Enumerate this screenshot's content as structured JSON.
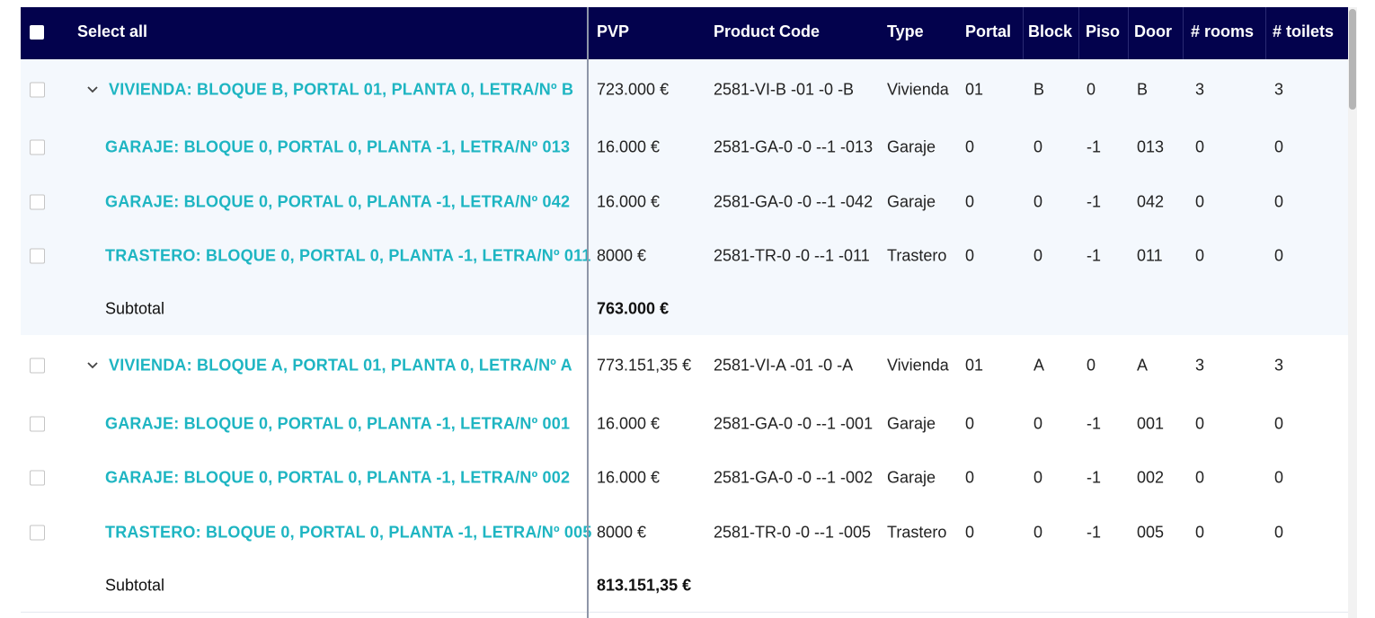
{
  "header": {
    "select_all": "Select all",
    "pvp": "PVP",
    "product_code": "Product Code",
    "type": "Type",
    "portal": "Portal",
    "block": "Block",
    "piso": "Piso",
    "door": "Door",
    "rooms": "# rooms",
    "toilets": "# toilets"
  },
  "colors": {
    "header_bg": "#03024d",
    "link": "#1eb5c2",
    "group_bg": "#f4f8fd"
  },
  "rows": [
    {
      "kind": "parent",
      "name": "VIVIENDA: BLOQUE B, PORTAL 01, PLANTA 0, LETRA/Nº B",
      "pvp": "723.000 €",
      "code": "2581-VI-B -01 -0 -B",
      "type": "Vivienda",
      "portal": "01",
      "block": "B",
      "piso": "0",
      "door": "B",
      "rooms": "3",
      "toilets": "3"
    },
    {
      "kind": "child",
      "name": "GARAJE: BLOQUE 0, PORTAL 0, PLANTA -1, LETRA/Nº 013",
      "pvp": "16.000 €",
      "code": "2581-GA-0 -0 --1 -013",
      "type": "Garaje",
      "portal": "0",
      "block": "0",
      "piso": "-1",
      "door": "013",
      "rooms": "0",
      "toilets": "0"
    },
    {
      "kind": "child",
      "name": "GARAJE: BLOQUE 0, PORTAL 0, PLANTA -1, LETRA/Nº 042",
      "pvp": "16.000 €",
      "code": "2581-GA-0 -0 --1 -042",
      "type": "Garaje",
      "portal": "0",
      "block": "0",
      "piso": "-1",
      "door": "042",
      "rooms": "0",
      "toilets": "0"
    },
    {
      "kind": "child",
      "name": "TRASTERO: BLOQUE 0, PORTAL 0, PLANTA -1, LETRA/Nº 011",
      "pvp": "8000 €",
      "code": "2581-TR-0 -0 --1 -011",
      "type": "Trastero",
      "portal": "0",
      "block": "0",
      "piso": "-1",
      "door": "011",
      "rooms": "0",
      "toilets": "0"
    },
    {
      "kind": "subtotal",
      "label": "Subtotal",
      "pvp": "763.000 €"
    },
    {
      "kind": "parent",
      "name": "VIVIENDA: BLOQUE A, PORTAL 01, PLANTA 0, LETRA/Nº A",
      "pvp": "773.151,35 €",
      "code": "2581-VI-A -01 -0 -A",
      "type": "Vivienda",
      "portal": "01",
      "block": "A",
      "piso": "0",
      "door": "A",
      "rooms": "3",
      "toilets": "3"
    },
    {
      "kind": "child",
      "name": "GARAJE: BLOQUE 0, PORTAL 0, PLANTA -1, LETRA/Nº 001",
      "pvp": "16.000 €",
      "code": "2581-GA-0 -0 --1 -001",
      "type": "Garaje",
      "portal": "0",
      "block": "0",
      "piso": "-1",
      "door": "001",
      "rooms": "0",
      "toilets": "0"
    },
    {
      "kind": "child",
      "name": "GARAJE: BLOQUE 0, PORTAL 0, PLANTA -1, LETRA/Nº 002",
      "pvp": "16.000 €",
      "code": "2581-GA-0 -0 --1 -002",
      "type": "Garaje",
      "portal": "0",
      "block": "0",
      "piso": "-1",
      "door": "002",
      "rooms": "0",
      "toilets": "0"
    },
    {
      "kind": "child",
      "name": "TRASTERO: BLOQUE 0, PORTAL 0, PLANTA -1, LETRA/Nº 005",
      "pvp": "8000 €",
      "code": "2581-TR-0 -0 --1 -005",
      "type": "Trastero",
      "portal": "0",
      "block": "0",
      "piso": "-1",
      "door": "005",
      "rooms": "0",
      "toilets": "0"
    },
    {
      "kind": "subtotal",
      "label": "Subtotal",
      "pvp": "813.151,35 €"
    }
  ]
}
